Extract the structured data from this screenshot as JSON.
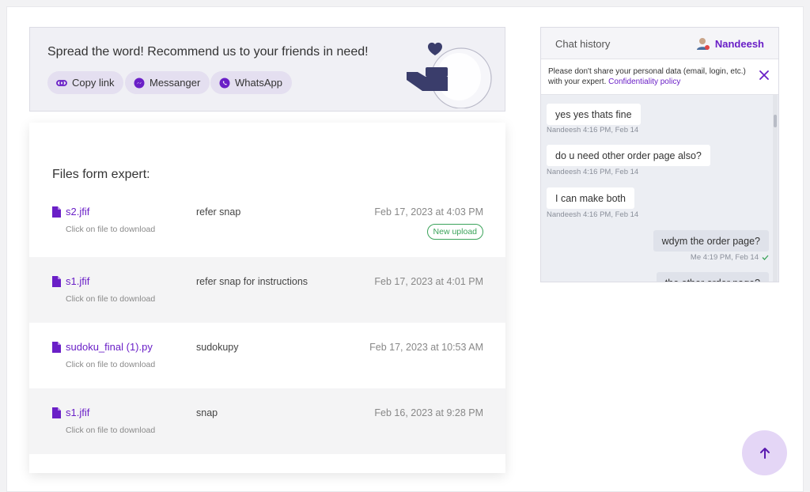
{
  "share": {
    "title": "Spread the word! Recommend us to your friends in need!",
    "copy_label": "Copy link",
    "messenger_label": "Messanger",
    "whatsapp_label": "WhatsApp",
    "accent": "#6a1fc7"
  },
  "files": {
    "title": "Files form expert:",
    "hint": "Click on file to download",
    "rows": [
      {
        "name": "s2.jfif",
        "hint": "Click on file to download",
        "desc": "refer snap",
        "date": "Feb 17, 2023 at 4:03 PM",
        "badge": "New upload"
      },
      {
        "name": "s1.jfif",
        "hint": "Click on file to download",
        "desc": "refer snap for instructions",
        "date": "Feb 17, 2023 at 4:01 PM"
      },
      {
        "name": "sudoku_final (1).py",
        "hint": "Click on file to download",
        "desc": "sudokupy",
        "date": "Feb 17, 2023 at 10:53 AM"
      },
      {
        "name": "s1.jfif",
        "hint": "Click on file to download",
        "desc": "snap",
        "date": "Feb 16, 2023 at 9:28 PM"
      }
    ]
  },
  "chat": {
    "title": "Chat history",
    "user": "Nandeesh",
    "notice_text": "Please don't share your personal data (email, login, etc.) with your expert.",
    "notice_link": "Confidentiality policy",
    "messages": [
      {
        "text": "yes yes thats fine",
        "meta": "Nandeesh 4:16 PM, Feb 14"
      },
      {
        "text": "do u need other order page also?",
        "meta": "Nandeesh 4:16 PM, Feb 14"
      },
      {
        "text": "I can make both",
        "meta": "Nandeesh 4:16 PM, Feb 14"
      },
      {
        "text": "wdym the order page?",
        "meta": "Me 4:19 PM, Feb 14"
      },
      {
        "text": "the other order page?",
        "meta": ""
      }
    ]
  },
  "fab": {
    "icon": "arrow-up-icon"
  }
}
